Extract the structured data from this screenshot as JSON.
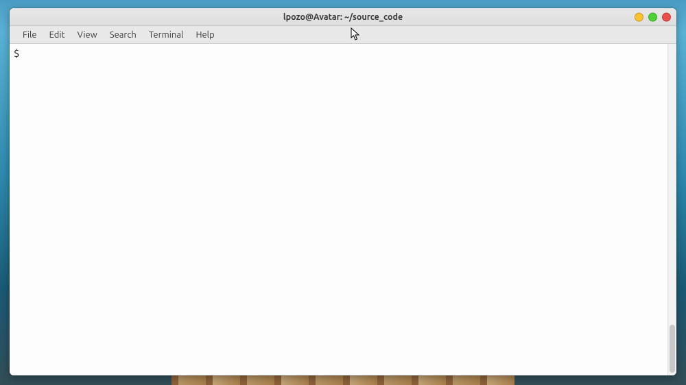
{
  "window": {
    "title": "lpozo@Avatar: ~/source_code"
  },
  "menubar": {
    "items": [
      "File",
      "Edit",
      "View",
      "Search",
      "Terminal",
      "Help"
    ]
  },
  "terminal": {
    "prompt": "$"
  }
}
